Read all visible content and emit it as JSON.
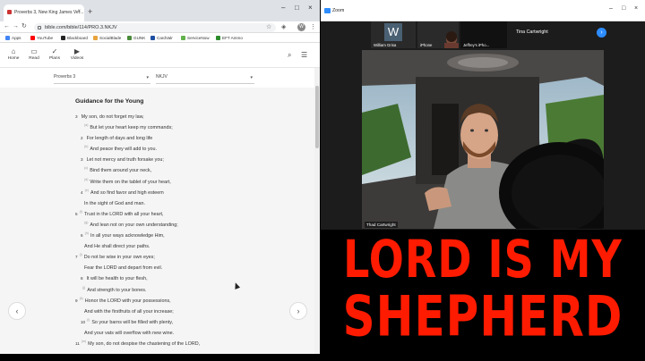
{
  "browser": {
    "tab_title": "Proverbs 3, New King James Ver...",
    "close": "×",
    "new_tab": "+",
    "window_controls": [
      "–",
      "□",
      "×"
    ],
    "url": "bible.com/bible/114/PRO.3.NKJV",
    "avatar": "W",
    "bookmarks": [
      {
        "label": "Apps",
        "color": "#4285f4"
      },
      {
        "label": "YouTube",
        "color": "#ff0000"
      },
      {
        "label": "Blackboard",
        "color": "#222222"
      },
      {
        "label": "SocialBlade",
        "color": "#e8a33d"
      },
      {
        "label": "GUNK",
        "color": "#4a8c3a"
      },
      {
        "label": "CardValr",
        "color": "#1f4fa0"
      },
      {
        "label": "ServiceNow",
        "color": "#62b14a"
      },
      {
        "label": "EFT Ammo",
        "color": "#2c8c2c"
      }
    ]
  },
  "app": {
    "nav": [
      {
        "label": "Home",
        "icon": "home-icon",
        "glyph": "⌂"
      },
      {
        "label": "Read",
        "icon": "book-icon",
        "glyph": "▭"
      },
      {
        "label": "Plans",
        "icon": "check-icon",
        "glyph": "✓"
      },
      {
        "label": "Videos",
        "icon": "video-icon",
        "glyph": "▶"
      }
    ],
    "book_select": "Proverbs 3",
    "version_select": "NKJV"
  },
  "reader": {
    "heading": "Guidance for the Young",
    "lines": [
      {
        "num": "3",
        "fn": "",
        "text": "My son, do not forget my law,",
        "indent": 0
      },
      {
        "num": "",
        "fn": "(a)",
        "text": "But let your heart keep my commands;",
        "indent": 8
      },
      {
        "num": "2",
        "fn": "",
        "text": "For length of days and long life",
        "indent": 6
      },
      {
        "num": "",
        "fn": "(b)",
        "text": "And peace they will add to you.",
        "indent": 8
      },
      {
        "num": "3",
        "fn": "",
        "text": "Let not mercy and truth forsake you;",
        "indent": 6
      },
      {
        "num": "",
        "fn": "(c)",
        "text": "Bind them around your neck,",
        "indent": 8
      },
      {
        "num": "",
        "fn": "(d)",
        "text": "Write them on the tablet of your heart,",
        "indent": 8
      },
      {
        "num": "4",
        "fn": "(e)",
        "text": "And so find favor and high esteem",
        "indent": 6
      },
      {
        "num": "",
        "fn": "",
        "text": "In the sight of God and man.",
        "indent": 6
      },
      {
        "num": "5",
        "fn": "(f)",
        "text": "Trust in the LORD with all your heart,",
        "indent": 0
      },
      {
        "num": "",
        "fn": "(g)",
        "text": "And lean not on your own understanding;",
        "indent": 8
      },
      {
        "num": "6",
        "fn": "(h)",
        "text": "In all your ways acknowledge Him,",
        "indent": 6
      },
      {
        "num": "",
        "fn": "",
        "text": "And He shall direct your paths.",
        "indent": 6
      },
      {
        "num": "7",
        "fn": "(i)",
        "text": "Do not be wise in your own eyes;",
        "indent": 0
      },
      {
        "num": "",
        "fn": "",
        "text": "Fear the LORD and depart from evil.",
        "indent": 6
      },
      {
        "num": "8",
        "fn": "",
        "text": "It will be health to your flesh,",
        "indent": 6
      },
      {
        "num": "",
        "fn": "(j)",
        "text": "And strength to your bones.",
        "indent": 6
      },
      {
        "num": "9",
        "fn": "(k)",
        "text": "Honor the LORD with your possessions,",
        "indent": 0
      },
      {
        "num": "",
        "fn": "",
        "text": "And with the firstfruits of all your increase;",
        "indent": 6
      },
      {
        "num": "10",
        "fn": "(l)",
        "text": "So your barns will be filled with plenty,",
        "indent": 6
      },
      {
        "num": "",
        "fn": "",
        "text": "And your vats will overflow with new wine.",
        "indent": 6
      },
      {
        "num": "11",
        "fn": "(m)",
        "text": "My son, do not despise the chastening of the LORD,",
        "indent": 0
      }
    ],
    "prev_arrow": "‹",
    "next_arrow": "›"
  },
  "zoom": {
    "title": "Zoom",
    "participants": [
      {
        "label": "William Grisa",
        "initial": "W"
      },
      {
        "label": "iPhone",
        "initial": ""
      },
      {
        "label": "Jeffrey's iPho...",
        "initial": ""
      }
    ],
    "active_speaker": "Tina Cartwright",
    "next": "›",
    "video_label": "Thad Cartwright"
  },
  "banner": {
    "line1": "LORD IS MY",
    "line2": "SHEPHERD"
  }
}
